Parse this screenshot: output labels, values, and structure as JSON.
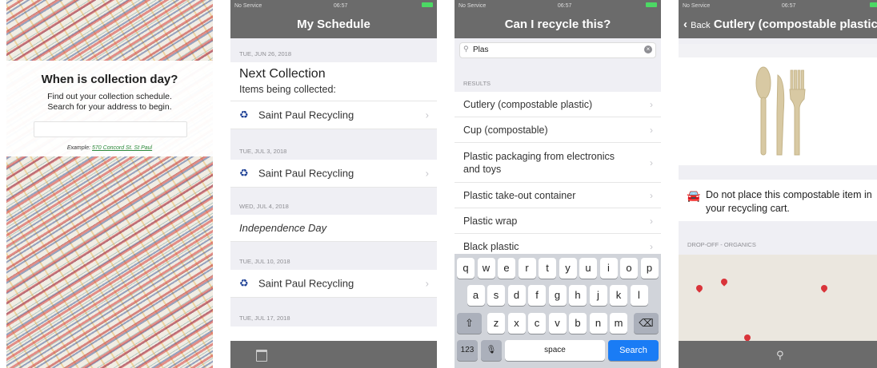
{
  "phone1": {
    "title": "When is collection day?",
    "subtitle_line1": "Find out your collection schedule.",
    "subtitle_line2": "Search for your address to begin.",
    "address_input_value": "",
    "example_prefix": "Example:",
    "example_link": "570 Concord St. St Paul"
  },
  "phone2": {
    "status": {
      "carrier": "No Service",
      "time": "06:57"
    },
    "nav_title": "My Schedule",
    "sections": [
      {
        "date": "TUE, JUN 26, 2018",
        "next_title": "Next Collection",
        "next_subtitle": "Items being collected:",
        "item": "Saint Paul Recycling"
      },
      {
        "date": "TUE, JUL 3, 2018",
        "item": "Saint Paul Recycling"
      },
      {
        "date": "WED, JUL 4, 2018",
        "holiday": "Independence Day"
      },
      {
        "date": "TUE, JUL 10, 2018",
        "item": "Saint Paul Recycling"
      },
      {
        "date": "TUE, JUL 17, 2018"
      }
    ],
    "recycle_icon": "recycle-icon",
    "calendar_icon": "calendar-icon"
  },
  "phone3": {
    "status": {
      "carrier": "No Service",
      "time": "06:57"
    },
    "nav_title": "Can I recycle this?",
    "search_value": "Plas",
    "results_header": "RESULTS",
    "results": [
      "Cutlery (compostable plastic)",
      "Cup (compostable)",
      "Plastic packaging from electronics and toys",
      "Plastic take-out container",
      "Plastic wrap",
      "Black plastic"
    ],
    "keyboard": {
      "row1": [
        "q",
        "w",
        "e",
        "r",
        "t",
        "y",
        "u",
        "i",
        "o",
        "p"
      ],
      "row2": [
        "a",
        "s",
        "d",
        "f",
        "g",
        "h",
        "j",
        "k",
        "l"
      ],
      "row3": [
        "z",
        "x",
        "c",
        "v",
        "b",
        "n",
        "m"
      ],
      "shift": "⇧",
      "delete": "⌫",
      "numbers": "123",
      "mic": "🎙",
      "space": "space",
      "search": "Search"
    }
  },
  "phone4": {
    "status": {
      "carrier": "No Service",
      "time": "06:57"
    },
    "back_label": "Back",
    "nav_title": "Cutlery (compostable plastic)",
    "message": "Do not place this compostable item in your recycling cart.",
    "dropoff_header": "DROP-OFF - ORGANICS",
    "car_icon": "car-icon",
    "zoom_icon": "zoom-icon"
  },
  "colors": {
    "navbar": "#6b6b6b",
    "link_green": "#2c8a3b",
    "search_blue": "#1a7cf5",
    "pin_red": "#d9343a"
  }
}
